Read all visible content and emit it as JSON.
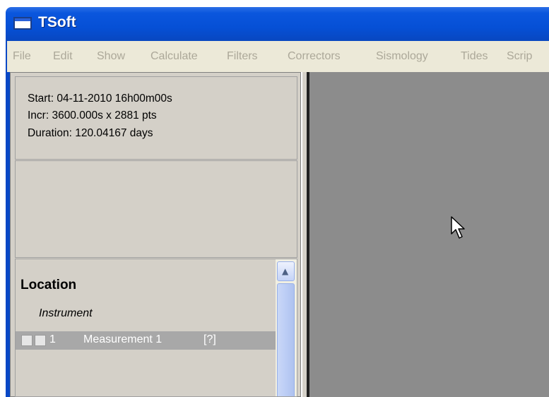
{
  "window": {
    "title": "TSoft"
  },
  "menu": {
    "items": [
      "File",
      "Edit",
      "Show",
      "Calculate",
      "Filters",
      "Correctors",
      "Sismology",
      "Tides",
      "Scrip"
    ]
  },
  "info": {
    "start": "Start: 04-11-2010 16h00m00s",
    "incr": "Incr: 3600.000s x 2881 pts",
    "duration": "Duration: 120.04167 days"
  },
  "list": {
    "location_title": "Location",
    "instrument_label": "Instrument",
    "rows": [
      {
        "number": "1",
        "name": "Measurement 1",
        "unit": "[?]"
      }
    ]
  },
  "colors": {
    "titlebar": "#0650d6",
    "menubar": "#ece9d8",
    "panel": "#d4d0c8",
    "plot_area": "#8c8c8c",
    "selected_row": "#a8a8a8"
  }
}
